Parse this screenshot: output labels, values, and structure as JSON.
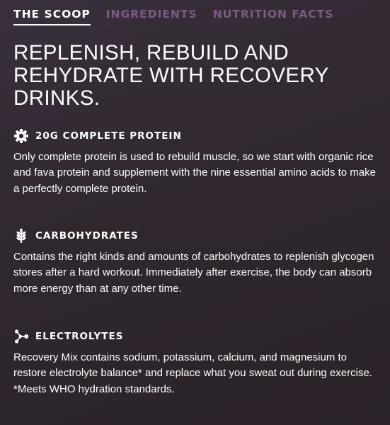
{
  "tabs": [
    {
      "label": "THE SCOOP",
      "active": true
    },
    {
      "label": "INGREDIENTS",
      "active": false
    },
    {
      "label": "NUTRITION FACTS",
      "active": false
    }
  ],
  "headline": "REPLENISH, REBUILD AND REHYDRATE WITH RECOVERY DRINKS.",
  "sections": [
    {
      "icon": "gear-icon",
      "title": "20G COMPLETE PROTEIN",
      "body": "Only complete protein is used to rebuild muscle, so we start with organic rice and fava protein and supplement with the nine essential amino acids to make a perfectly complete protein."
    },
    {
      "icon": "wheat-icon",
      "title": "CARBOHYDRATES",
      "body": "Contains the right kinds and amounts of carbohydrates to replenish glycogen stores after a hard workout. Immediately after exercise, the body can absorb more energy than at any other time."
    },
    {
      "icon": "molecule-icon",
      "title": "ELECTROLYTES",
      "body": "Recovery Mix contains sodium, potassium, calcium, and magnesium to restore electrolyte balance* and replace what you sweat out during exercise. *Meets WHO hydration standards."
    }
  ],
  "colors": {
    "background": "#30272f",
    "tab_inactive": "#7c5a83",
    "text": "#ffffff"
  }
}
